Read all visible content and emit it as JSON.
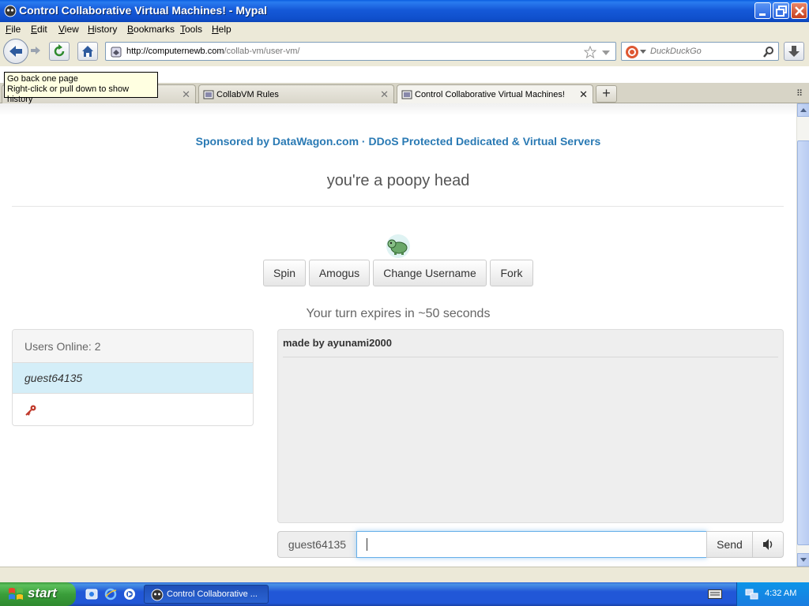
{
  "window": {
    "title": "Control Collaborative Virtual Machines! - Mypal"
  },
  "menu": {
    "items": [
      {
        "label": "File"
      },
      {
        "label": "Edit"
      },
      {
        "label": "View"
      },
      {
        "label": "History"
      },
      {
        "label": "Bookmarks"
      },
      {
        "label": "Tools"
      },
      {
        "label": "Help"
      }
    ]
  },
  "nav": {
    "url_host": "http://computernewb.com",
    "url_path": "/collab-vm/user-vm/",
    "search_placeholder": "DuckDuckGo"
  },
  "tooltip": {
    "line1": "Go back one page",
    "line2": "Right-click or pull down to show history"
  },
  "tabs": [
    {
      "label": ""
    },
    {
      "label": "CollabVM Rules"
    },
    {
      "label": "Control Collaborative Virtual Machines!"
    }
  ],
  "page": {
    "sponsor": "Sponsored by DataWagon.com · DDoS Protected Dedicated & Virtual Servers",
    "motd": "you're a poopy head",
    "buttons": [
      {
        "label": "Spin"
      },
      {
        "label": "Amogus"
      },
      {
        "label": "Change Username"
      },
      {
        "label": "Fork"
      }
    ],
    "turn_status": "Your turn expires in ~50 seconds",
    "users": {
      "header": "Users Online: 2",
      "list": [
        {
          "name": "guest64135"
        }
      ]
    },
    "chat": {
      "messages": [
        {
          "text": "made by ayunami2000"
        }
      ]
    },
    "input": {
      "username": "guest64135",
      "value": "",
      "send_label": "Send"
    }
  },
  "taskbar": {
    "start_label": "start",
    "task_label": "Control Collaborative ...",
    "clock": "4:32 AM"
  }
}
